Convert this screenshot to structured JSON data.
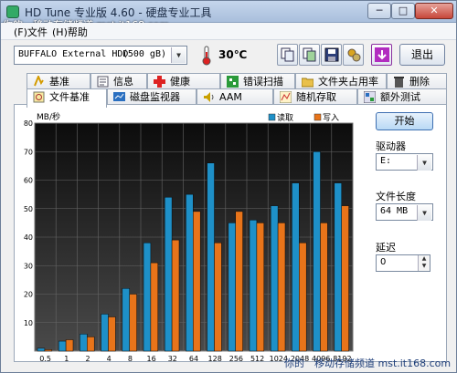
{
  "titlebar": {
    "title": "HD Tune 专业版 4.60 - 硬盘专业工具"
  },
  "watermark": {
    "text": "你的　移动存储频道  mst.it168.com"
  },
  "menu": {
    "items": [
      "(F)文件",
      "(H)帮助"
    ]
  },
  "toolbar": {
    "drive": "BUFFALO External HDD",
    "capacity": "(500 gB)",
    "temperature": "30℃",
    "exit_label": "退出"
  },
  "tabs_top": [
    "基准",
    "信息",
    "健康",
    "错误扫描",
    "文件夹占用率",
    "删除"
  ],
  "tabs_bottom": [
    "文件基准",
    "磁盘监视器",
    "AAM",
    "随机存取",
    "额外测试"
  ],
  "side": {
    "start_label": "开始",
    "drive_label": "驱动器",
    "drive_value": "E:",
    "filesize_label": "文件长度",
    "filesize_value": "64 MB",
    "delay_label": "延迟",
    "delay_value": "0"
  },
  "chart_data": {
    "type": "bar",
    "ylabel": "MB/秒",
    "ylim": [
      0,
      80
    ],
    "yticks": [
      10,
      20,
      30,
      40,
      50,
      60,
      70,
      80
    ],
    "categories": [
      "0.5",
      "1",
      "2",
      "4",
      "8",
      "16",
      "32",
      "64",
      "128",
      "256",
      "512",
      "1024",
      "2048",
      "4096",
      "8192"
    ],
    "series": [
      {
        "name": "读取",
        "color": "#1e90c8",
        "values": [
          1,
          3.5,
          6,
          13,
          22,
          38,
          54,
          55,
          66,
          45,
          46,
          51,
          59,
          70,
          59
        ]
      },
      {
        "name": "写入",
        "color": "#e8741a",
        "values": [
          0.5,
          4,
          5,
          12,
          20,
          31,
          39,
          49,
          38,
          49,
          45,
          45,
          38,
          45,
          51
        ]
      }
    ],
    "legend": "top-right",
    "grid": true
  }
}
